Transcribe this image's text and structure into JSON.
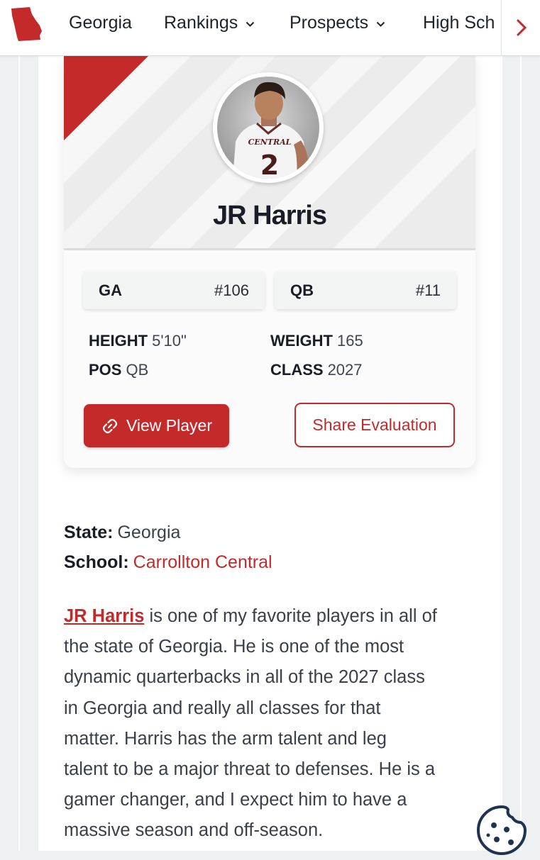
{
  "nav": {
    "items": [
      {
        "label": "Georgia"
      },
      {
        "label": "Rankings"
      },
      {
        "label": "Prospects"
      },
      {
        "label": "High Sch"
      }
    ]
  },
  "player": {
    "name": "JR Harris",
    "state_rank_label": "GA",
    "state_rank": "#106",
    "position_rank_label": "QB",
    "position_rank": "#11",
    "height_label": "HEIGHT",
    "height": "5'10\"",
    "weight_label": "WEIGHT",
    "weight": "165",
    "pos_label": "POS",
    "pos": "QB",
    "class_label": "CLASS",
    "class": "2027",
    "jersey_text": "CENTRAL",
    "jersey_number": "2"
  },
  "buttons": {
    "view_player": "View Player",
    "share": "Share Evaluation"
  },
  "meta": {
    "state_label": "State:",
    "state": "Georgia",
    "school_label": "School:",
    "school": "Carrollton Central"
  },
  "bio": {
    "name_link": "JR Harris",
    "line1": " is one of my favorite players in all of",
    "line2": "the state of Georgia. He is one of the most",
    "line3": "dynamic quarterbacks in all of the 2027 class",
    "line4": "in Georgia and really all classes for that",
    "line5": "matter. Harris has the arm talent and leg",
    "line6": "talent to be a major threat to defenses. He is a",
    "line7": "gamer changer, and I expect him to have a",
    "line8": "massive season and off-season."
  },
  "colors": {
    "accent": "#c42a2a",
    "text": "#1a1d27",
    "background": "#eef1f2"
  }
}
